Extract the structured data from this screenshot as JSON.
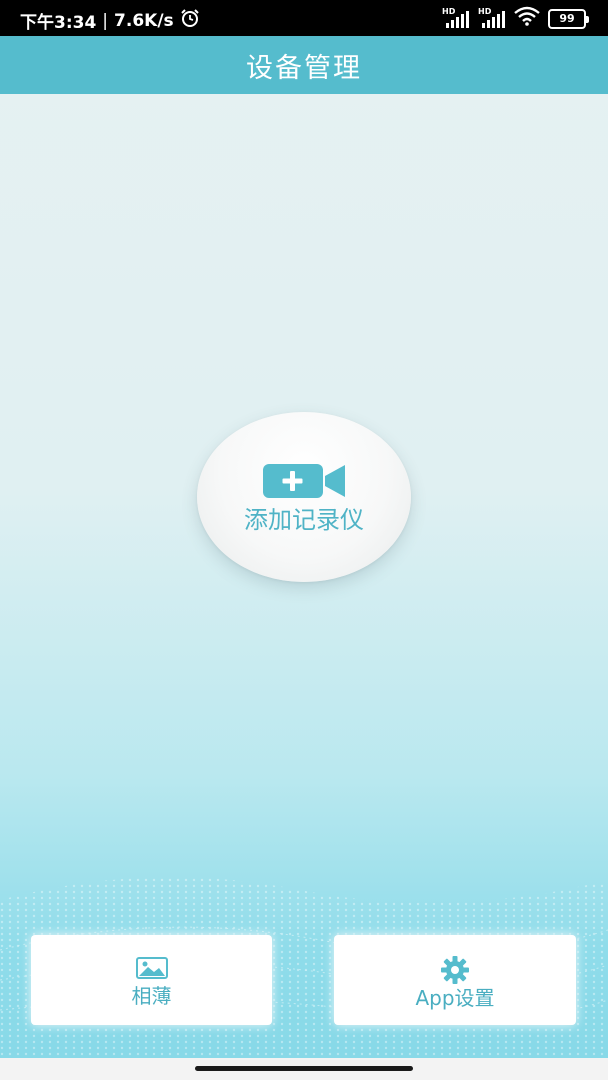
{
  "status_bar": {
    "time": "下午3:34",
    "separator": "|",
    "net_speed": "7.6K/s",
    "alarm_icon": "alarm-clock-icon",
    "signal_1_label": "HD",
    "signal_2_label": "HD",
    "wifi_icon": "wifi-icon",
    "battery_level": "99"
  },
  "header": {
    "title": "设备管理"
  },
  "main": {
    "add_device": {
      "icon": "video-camera-plus-icon",
      "label": "添加记录仪"
    }
  },
  "bottom_nav": {
    "album": {
      "icon": "image-icon",
      "label": "相薄"
    },
    "settings": {
      "icon": "gear-icon",
      "label": "App设置"
    }
  },
  "colors": {
    "accent": "#55bccd",
    "label_teal": "#4fb3c6",
    "status_bar_bg": "#000000"
  }
}
